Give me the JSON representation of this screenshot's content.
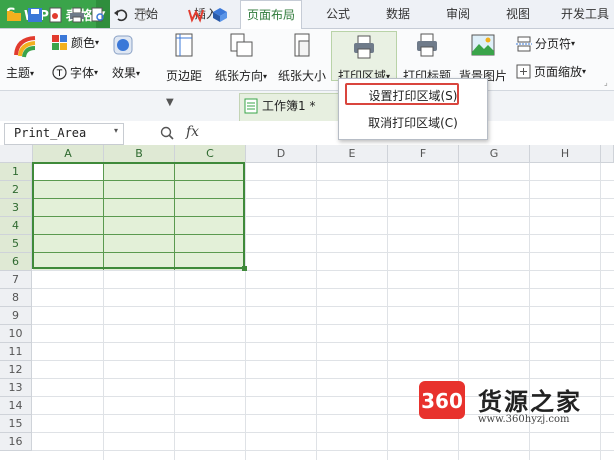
{
  "app": {
    "logo": "S",
    "name": "WPS 表格"
  },
  "tabs": [
    "开始",
    "插入",
    "页面布局",
    "公式",
    "数据",
    "审阅",
    "视图",
    "开发工具"
  ],
  "active_tab": "页面布局",
  "ribbon": {
    "theme": "主题",
    "colors": "颜色",
    "fonts": "字体",
    "effects": "效果",
    "margins": "页边距",
    "orientation": "纸张方向",
    "size": "纸张大小",
    "print_area": "打印区域",
    "print_titles": "打印标题",
    "background": "背景图片",
    "breaks": "分页符",
    "scale": "页面缩放"
  },
  "quick_toolbar": {
    "document_tab": "工作簿1 *"
  },
  "formula_bar": {
    "name_box": "Print_Area",
    "fx": "fx"
  },
  "grid": {
    "columns": [
      "A",
      "B",
      "C",
      "D",
      "E",
      "F",
      "G",
      "H"
    ],
    "rows": [
      "1",
      "2",
      "3",
      "4",
      "5",
      "6",
      "7",
      "8",
      "9",
      "10",
      "11",
      "12",
      "13",
      "14",
      "15",
      "16"
    ],
    "selected_range": "A1:C6"
  },
  "menu": {
    "items": [
      "设置打印区域(S)",
      "取消打印区域(C)"
    ],
    "highlighted": "设置打印区域(S)"
  },
  "watermark": {
    "badge": "360",
    "name": "货源之家",
    "url": "www.360hyzj.com"
  },
  "colors": {
    "accent": "#3aa44a",
    "selection": "#e3f0d8",
    "highlight_box": "#d9453d"
  }
}
